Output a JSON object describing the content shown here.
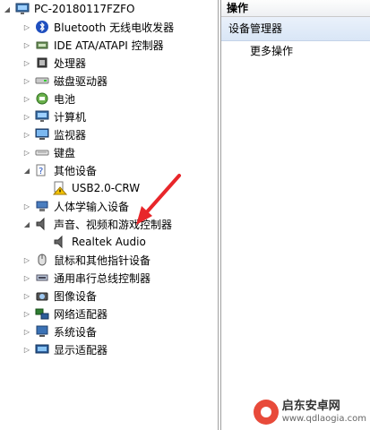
{
  "tree": {
    "root": {
      "label": "PC-20180117FZFO",
      "icon": "computer-root-icon"
    },
    "items": [
      {
        "label": "Bluetooth 无线电收发器",
        "icon": "bluetooth-icon",
        "expanded": false
      },
      {
        "label": "IDE ATA/ATAPI 控制器",
        "icon": "ide-controller-icon",
        "expanded": false
      },
      {
        "label": "处理器",
        "icon": "processor-icon",
        "expanded": false
      },
      {
        "label": "磁盘驱动器",
        "icon": "disk-drive-icon",
        "expanded": false
      },
      {
        "label": "电池",
        "icon": "battery-icon",
        "expanded": false
      },
      {
        "label": "计算机",
        "icon": "computer-icon",
        "expanded": false
      },
      {
        "label": "监视器",
        "icon": "monitor-icon",
        "expanded": false
      },
      {
        "label": "键盘",
        "icon": "keyboard-icon",
        "expanded": false
      },
      {
        "label": "其他设备",
        "icon": "other-devices-icon",
        "expanded": true,
        "children": [
          {
            "label": "USB2.0-CRW",
            "icon": "unknown-device-warning-icon"
          }
        ]
      },
      {
        "label": "人体学输入设备",
        "icon": "hid-icon",
        "expanded": false
      },
      {
        "label": "声音、视频和游戏控制器",
        "icon": "sound-icon",
        "expanded": true,
        "children": [
          {
            "label": "Realtek Audio",
            "icon": "speaker-icon"
          }
        ]
      },
      {
        "label": "鼠标和其他指针设备",
        "icon": "mouse-icon",
        "expanded": false
      },
      {
        "label": "通用串行总线控制器",
        "icon": "usb-icon",
        "expanded": false
      },
      {
        "label": "图像设备",
        "icon": "camera-icon",
        "expanded": false
      },
      {
        "label": "网络适配器",
        "icon": "network-icon",
        "expanded": false
      },
      {
        "label": "系统设备",
        "icon": "system-icon",
        "expanded": false
      },
      {
        "label": "显示适配器",
        "icon": "display-adapter-icon",
        "expanded": false
      }
    ]
  },
  "actions": {
    "header": "操作",
    "section": "设备管理器",
    "items": [
      {
        "label": "更多操作"
      }
    ]
  },
  "watermark": {
    "name": "启东安卓网",
    "url": "www.qdlaogia.com"
  },
  "colors": {
    "annotation_arrow": "#e8262a",
    "selection_bar": "#d9e6f6"
  }
}
